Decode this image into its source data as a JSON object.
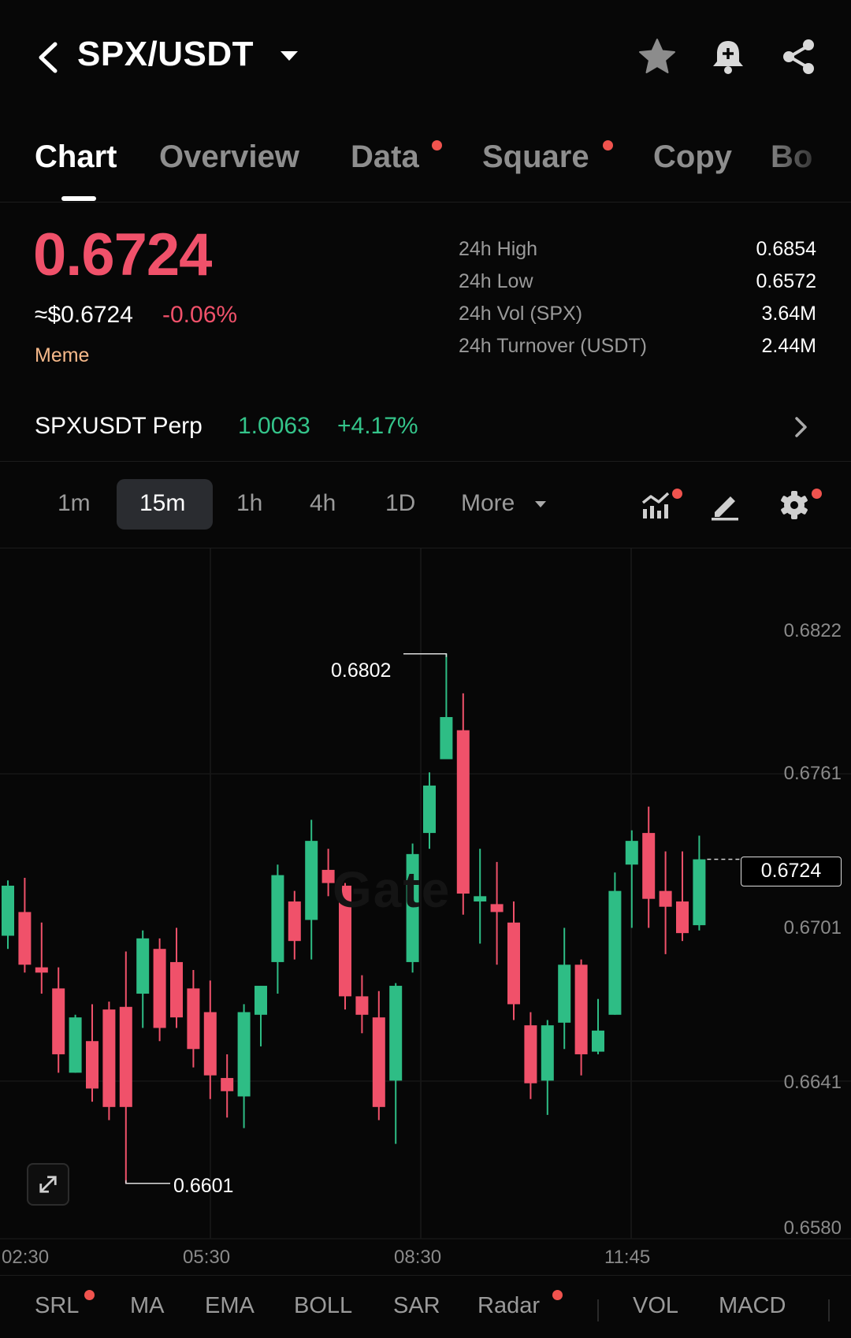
{
  "header": {
    "pair": "SPX/USDT",
    "icons": [
      "back-arrow-icon",
      "caret-down-icon",
      "star-icon",
      "bell-plus-icon",
      "share-icon"
    ]
  },
  "tabs": [
    {
      "label": "Chart",
      "active": true,
      "dot": false
    },
    {
      "label": "Overview",
      "active": false,
      "dot": false
    },
    {
      "label": "Data",
      "active": false,
      "dot": true
    },
    {
      "label": "Square",
      "active": false,
      "dot": true
    },
    {
      "label": "Copy",
      "active": false,
      "dot": false
    },
    {
      "label": "Bo",
      "active": false,
      "dot": false
    }
  ],
  "ticker": {
    "last_price": "0.6724",
    "usd_price": "≈$0.6724",
    "change": "-0.06%",
    "tag": "Meme",
    "stats": [
      {
        "label": "24h High",
        "value": "0.6854"
      },
      {
        "label": "24h Low",
        "value": "0.6572"
      },
      {
        "label": "24h Vol (SPX)",
        "value": "3.64M"
      },
      {
        "label": "24h Turnover (USDT)",
        "value": "2.44M"
      }
    ]
  },
  "perp": {
    "name": "SPXUSDT Perp",
    "price": "1.0063",
    "change": "+4.17%"
  },
  "intervals": {
    "items": [
      "1m",
      "15m",
      "1h",
      "4h",
      "1D",
      "More"
    ],
    "selected": "15m",
    "tool_icons": [
      "indicator-chart-icon",
      "draw-pen-icon",
      "settings-gear-icon"
    ]
  },
  "colors": {
    "up": "#2ebd85",
    "down": "#f0516a",
    "background": "#070707"
  },
  "watermark": "Gate",
  "chart_data": {
    "type": "candlestick",
    "interval": "15m",
    "ylim": [
      0.658,
      0.6842
    ],
    "y_ticks": [
      "0.6822",
      "0.6761",
      "0.6701",
      "0.6641",
      "0.6580"
    ],
    "x_ticks": [
      "02:30",
      "05:30",
      "08:30",
      "11:45"
    ],
    "last_price": "0.6724",
    "high_marker": "0.6802",
    "low_marker": "0.6601",
    "candles": [
      {
        "o": 0.6695,
        "h": 0.6716,
        "l": 0.669,
        "c": 0.6714
      },
      {
        "o": 0.6704,
        "h": 0.6717,
        "l": 0.6681,
        "c": 0.6684
      },
      {
        "o": 0.6683,
        "h": 0.67,
        "l": 0.6673,
        "c": 0.6681
      },
      {
        "o": 0.6675,
        "h": 0.6683,
        "l": 0.6643,
        "c": 0.665
      },
      {
        "o": 0.6643,
        "h": 0.6665,
        "l": 0.6643,
        "c": 0.6664
      },
      {
        "o": 0.6655,
        "h": 0.6669,
        "l": 0.6632,
        "c": 0.6637
      },
      {
        "o": 0.6667,
        "h": 0.667,
        "l": 0.6625,
        "c": 0.663
      },
      {
        "o": 0.6668,
        "h": 0.6689,
        "l": 0.6601,
        "c": 0.663
      },
      {
        "o": 0.6673,
        "h": 0.6697,
        "l": 0.666,
        "c": 0.6694
      },
      {
        "o": 0.669,
        "h": 0.6694,
        "l": 0.6655,
        "c": 0.666
      },
      {
        "o": 0.6685,
        "h": 0.6698,
        "l": 0.666,
        "c": 0.6664
      },
      {
        "o": 0.6675,
        "h": 0.6682,
        "l": 0.6645,
        "c": 0.6652
      },
      {
        "o": 0.6666,
        "h": 0.6678,
        "l": 0.6633,
        "c": 0.6642
      },
      {
        "o": 0.6641,
        "h": 0.665,
        "l": 0.6626,
        "c": 0.6636
      },
      {
        "o": 0.6634,
        "h": 0.6669,
        "l": 0.6622,
        "c": 0.6666
      },
      {
        "o": 0.6665,
        "h": 0.6676,
        "l": 0.6653,
        "c": 0.6676
      },
      {
        "o": 0.6685,
        "h": 0.6722,
        "l": 0.6673,
        "c": 0.6718
      },
      {
        "o": 0.6708,
        "h": 0.6712,
        "l": 0.6686,
        "c": 0.6693
      },
      {
        "o": 0.6701,
        "h": 0.6739,
        "l": 0.6686,
        "c": 0.6731
      },
      {
        "o": 0.672,
        "h": 0.6728,
        "l": 0.671,
        "c": 0.6715
      },
      {
        "o": 0.6714,
        "h": 0.6715,
        "l": 0.6667,
        "c": 0.6672
      },
      {
        "o": 0.6672,
        "h": 0.668,
        "l": 0.6658,
        "c": 0.6665
      },
      {
        "o": 0.6664,
        "h": 0.6674,
        "l": 0.6625,
        "c": 0.663
      },
      {
        "o": 0.664,
        "h": 0.6677,
        "l": 0.6616,
        "c": 0.6676
      },
      {
        "o": 0.6685,
        "h": 0.673,
        "l": 0.6681,
        "c": 0.6726
      },
      {
        "o": 0.6734,
        "h": 0.6757,
        "l": 0.6728,
        "c": 0.6752
      },
      {
        "o": 0.6762,
        "h": 0.6802,
        "l": 0.6766,
        "c": 0.6778
      },
      {
        "o": 0.6773,
        "h": 0.6787,
        "l": 0.6703,
        "c": 0.6711
      },
      {
        "o": 0.6708,
        "h": 0.6728,
        "l": 0.6692,
        "c": 0.671
      },
      {
        "o": 0.6707,
        "h": 0.6723,
        "l": 0.6684,
        "c": 0.6704
      },
      {
        "o": 0.67,
        "h": 0.6708,
        "l": 0.6663,
        "c": 0.6669
      },
      {
        "o": 0.6661,
        "h": 0.6666,
        "l": 0.6633,
        "c": 0.6639
      },
      {
        "o": 0.664,
        "h": 0.6663,
        "l": 0.6627,
        "c": 0.6661
      },
      {
        "o": 0.6662,
        "h": 0.6698,
        "l": 0.6652,
        "c": 0.6684
      },
      {
        "o": 0.6684,
        "h": 0.6686,
        "l": 0.6642,
        "c": 0.665
      },
      {
        "o": 0.6651,
        "h": 0.6671,
        "l": 0.665,
        "c": 0.6659
      },
      {
        "o": 0.6665,
        "h": 0.6719,
        "l": 0.6665,
        "c": 0.6712
      },
      {
        "o": 0.6722,
        "h": 0.6735,
        "l": 0.6698,
        "c": 0.6731
      },
      {
        "o": 0.6734,
        "h": 0.6744,
        "l": 0.6698,
        "c": 0.6709
      },
      {
        "o": 0.6712,
        "h": 0.6727,
        "l": 0.6688,
        "c": 0.6706
      },
      {
        "o": 0.6708,
        "h": 0.6727,
        "l": 0.6693,
        "c": 0.6696
      },
      {
        "o": 0.6699,
        "h": 0.6733,
        "l": 0.6697,
        "c": 0.6724
      }
    ]
  },
  "indicators": [
    {
      "label": "SRL",
      "dot": true
    },
    {
      "label": "MA",
      "dot": false
    },
    {
      "label": "EMA",
      "dot": false
    },
    {
      "label": "BOLL",
      "dot": false
    },
    {
      "label": "SAR",
      "dot": false
    },
    {
      "label": "Radar",
      "dot": true
    },
    {
      "label": "VOL",
      "dot": false
    },
    {
      "label": "MACD",
      "dot": false
    }
  ]
}
